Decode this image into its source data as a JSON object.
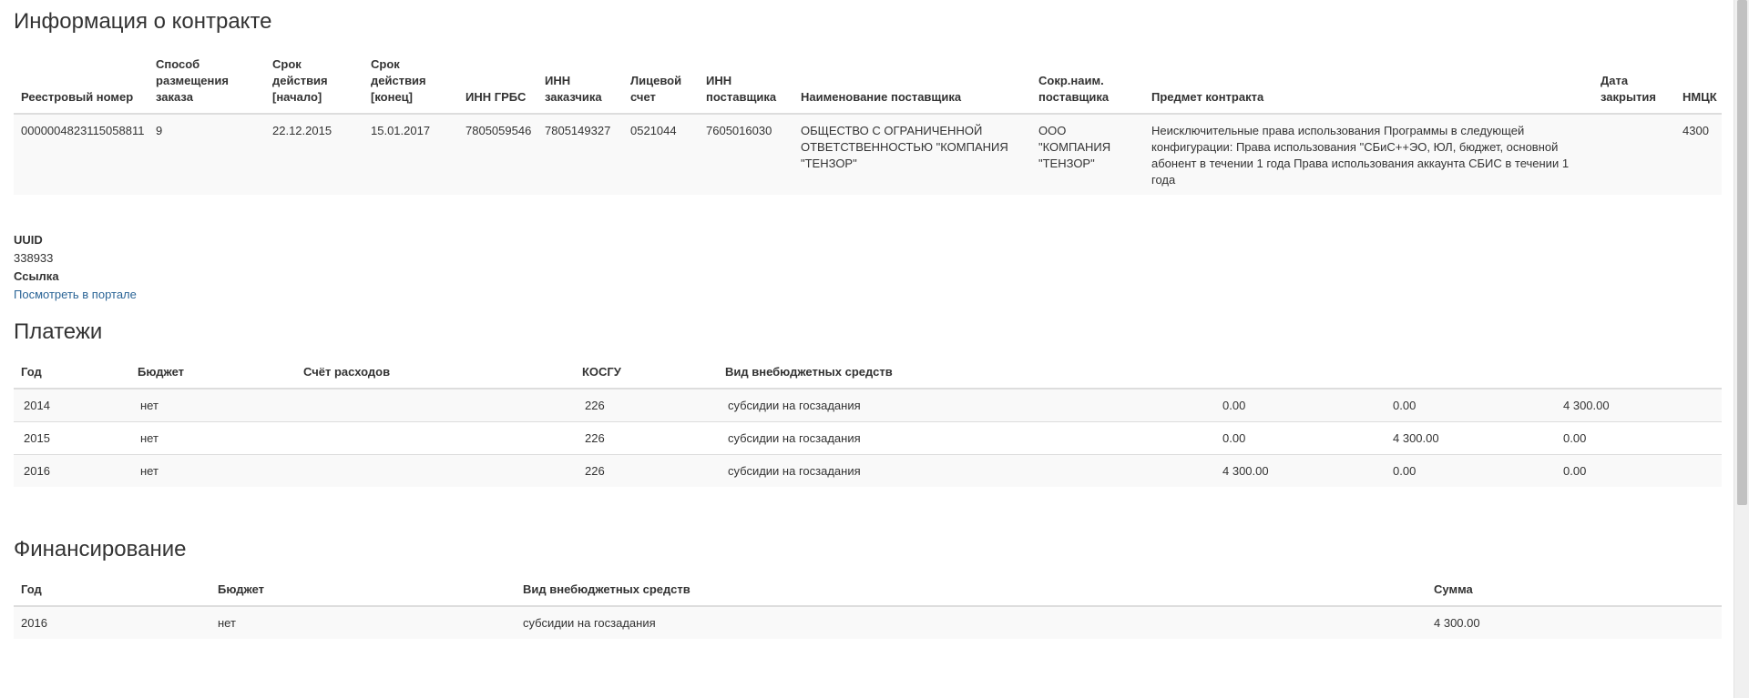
{
  "contract": {
    "title": "Информация о контракте",
    "headers": [
      "Реестровый номер",
      "Способ размещения заказа",
      "Срок действия [начало]",
      "Срок действия [конец]",
      "ИНН ГРБС",
      "ИНН заказчика",
      "Лицевой счет",
      "ИНН поставщика",
      "Наименование поставщика",
      "Сокр.наим. поставщика",
      "Предмет контракта",
      "Дата закрытия",
      "НМЦК"
    ],
    "row": {
      "reg_number": "0000004823115058811",
      "method": "9",
      "start": "22.12.2015",
      "end": "15.01.2017",
      "inn_grbs": "7805059546",
      "inn_customer": "7805149327",
      "account": "0521044",
      "inn_supplier": "7605016030",
      "supplier_name": "ОБЩЕСТВО С ОГРАНИЧЕННОЙ ОТВЕТСТВЕННОСТЬЮ \"КОМПАНИЯ \"ТЕНЗОР\"",
      "supplier_short": "ООО \"КОМПАНИЯ \"ТЕНЗОР\"",
      "subject": "Неисключительные права использования Программы в следующей конфигурации: Права использования \"СБиС++ЭО, ЮЛ, бюджет, основной абонент в течении 1 года Права использования аккаунта СБИС в течении 1 года",
      "close_date": "",
      "nmck": "4300"
    }
  },
  "info": {
    "uuid_label": "UUID",
    "uuid_value": "338933",
    "link_label": "Ссылка",
    "link_text": "Посмотреть в портале"
  },
  "payments": {
    "title": "Платежи",
    "headers": [
      "Год",
      "Бюджет",
      "Счёт расходов",
      "КОСГУ",
      "Вид внебюджетных средств",
      "",
      "",
      ""
    ],
    "rows": [
      {
        "year": "2014",
        "budget": "нет",
        "account": "",
        "kosgu": "226",
        "fund": "субсидии на госзадания",
        "v1": "0.00",
        "v2": "0.00",
        "v3": "4 300.00"
      },
      {
        "year": "2015",
        "budget": "нет",
        "account": "",
        "kosgu": "226",
        "fund": "субсидии на госзадания",
        "v1": "0.00",
        "v2": "4 300.00",
        "v3": "0.00"
      },
      {
        "year": "2016",
        "budget": "нет",
        "account": "",
        "kosgu": "226",
        "fund": "субсидии на госзадания",
        "v1": "4 300.00",
        "v2": "0.00",
        "v3": "0.00"
      }
    ]
  },
  "financing": {
    "title": "Финансирование",
    "headers": [
      "Год",
      "Бюджет",
      "Вид внебюджетных средств",
      "Сумма"
    ],
    "rows": [
      {
        "year": "2016",
        "budget": "нет",
        "fund": "субсидии на госзадания",
        "sum": "4 300.00"
      }
    ]
  }
}
